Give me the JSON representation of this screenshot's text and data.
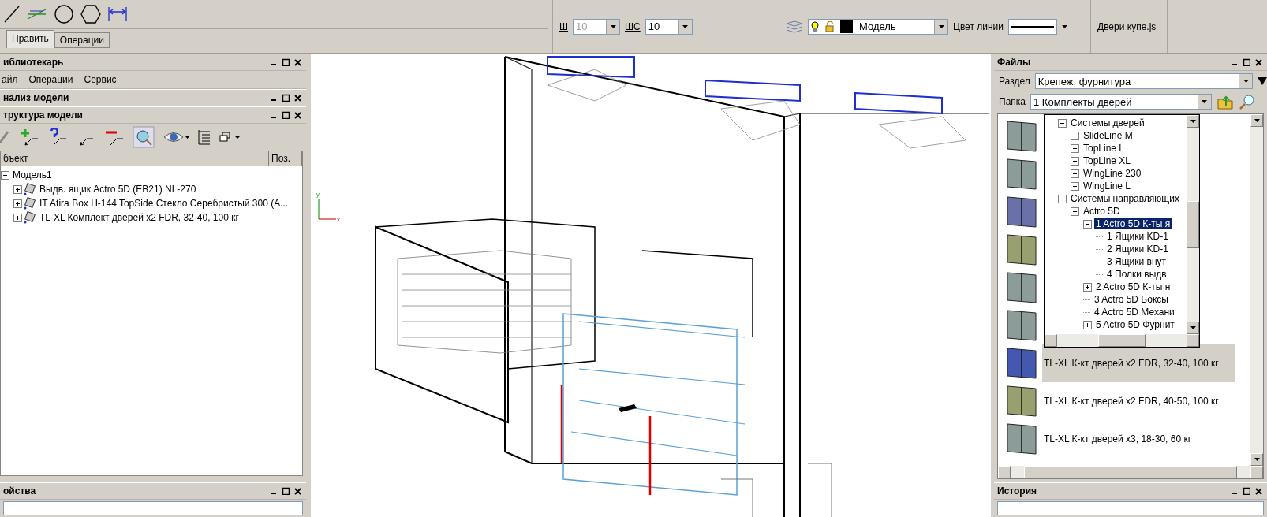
{
  "toolbar": {
    "tabs": [
      {
        "label": "Править",
        "selected": true
      },
      {
        "label": "Операции",
        "selected": false
      }
    ],
    "line_width": {
      "label": "Ш",
      "value": "10",
      "disabled": true
    },
    "line_step": {
      "label": "ШС",
      "value": "10",
      "disabled": false
    },
    "layer": {
      "value": "Модель"
    },
    "line_color": {
      "label": "Цвет линии"
    },
    "script": "Двери купе.js"
  },
  "left_panel": {
    "librarian": {
      "title": "иблиотекарь",
      "menu": [
        "айл",
        "Операции",
        "Сервис"
      ]
    },
    "analysis": {
      "title": "нализ модели"
    },
    "structure": {
      "title": "труктура модели",
      "columns": [
        "бъект",
        "Поз."
      ],
      "tree": [
        {
          "label": "Модель1",
          "expanded": true,
          "children": [
            {
              "label": "Выдв. ящик Actro 5D (EB21) NL-270",
              "expanded": false
            },
            {
              "label": "IT Atira Box H-144 TopSide Стекло Серебристый 300 (A...",
              "expanded": false
            },
            {
              "label": "TL-XL Комплект дверей x2 FDR, 32-40, 100 кг",
              "expanded": false
            }
          ]
        }
      ]
    },
    "properties": {
      "title": "ойства"
    }
  },
  "viewport": {
    "axis_labels": [
      "y",
      "x"
    ]
  },
  "files": {
    "title": "Файлы",
    "section": {
      "label": "Раздел",
      "value": "Крепеж, фурнитура"
    },
    "folder": {
      "label": "Папка",
      "value": "1 Комплекты дверей"
    },
    "folder_tree": [
      {
        "label": "Системы дверей",
        "expanded": true,
        "selected": false,
        "children": [
          {
            "label": "SlideLine M",
            "expanded": false,
            "selected": false
          },
          {
            "label": "TopLine L",
            "expanded": false,
            "selected": false
          },
          {
            "label": "TopLine XL",
            "expanded": false,
            "selected": false
          },
          {
            "label": "WingLine 230",
            "expanded": false,
            "selected": false
          },
          {
            "label": "WingLine L",
            "expanded": false,
            "selected": false
          }
        ]
      },
      {
        "label": "Системы направляющих",
        "expanded": true,
        "selected": false,
        "children": [
          {
            "label": "Actro 5D",
            "expanded": true,
            "selected": false,
            "children": [
              {
                "label": "1 Actro 5D К-ты я",
                "expanded": true,
                "selected": true,
                "children": [
                  {
                    "label": "1 Ящики KD-1",
                    "selected": false
                  },
                  {
                    "label": "2 Ящики KD-1",
                    "selected": false
                  },
                  {
                    "label": "3 Ящики внут",
                    "selected": false
                  },
                  {
                    "label": "4 Полки выдв",
                    "selected": false
                  }
                ]
              },
              {
                "label": "2 Actro 5D К-ты н",
                "expanded": false,
                "selected": false
              },
              {
                "label": "3 Actro 5D Боксы",
                "selected": false
              },
              {
                "label": "4 Actro 5D Механи",
                "selected": false
              },
              {
                "label": "5 Actro 5D Фурнит",
                "expanded": false,
                "selected": false
              }
            ]
          }
        ]
      }
    ],
    "items": [
      {
        "color": "#8c9c98",
        "selected": false
      },
      {
        "color": "#8c9c98",
        "selected": false
      },
      {
        "color": "#6a70a8",
        "selected": false
      },
      {
        "color": "#98a070",
        "selected": false
      },
      {
        "color": "#8c9c98",
        "selected": false
      },
      {
        "color": "#8c9c98",
        "selected": false
      },
      {
        "label": "TL-XL К-кт дверей x2 FDR, 32-40, 100 кг",
        "color": "#4458b0",
        "selected": true
      },
      {
        "label": "TL-XL К-кт дверей x2 FDR, 40-50, 100 кг",
        "color": "#98a070",
        "selected": false
      },
      {
        "label": "TL-XL К-кт дверей x3, 18-30, 60 кг",
        "color": "#8c9c98",
        "selected": false
      }
    ]
  },
  "history": {
    "title": "История"
  }
}
